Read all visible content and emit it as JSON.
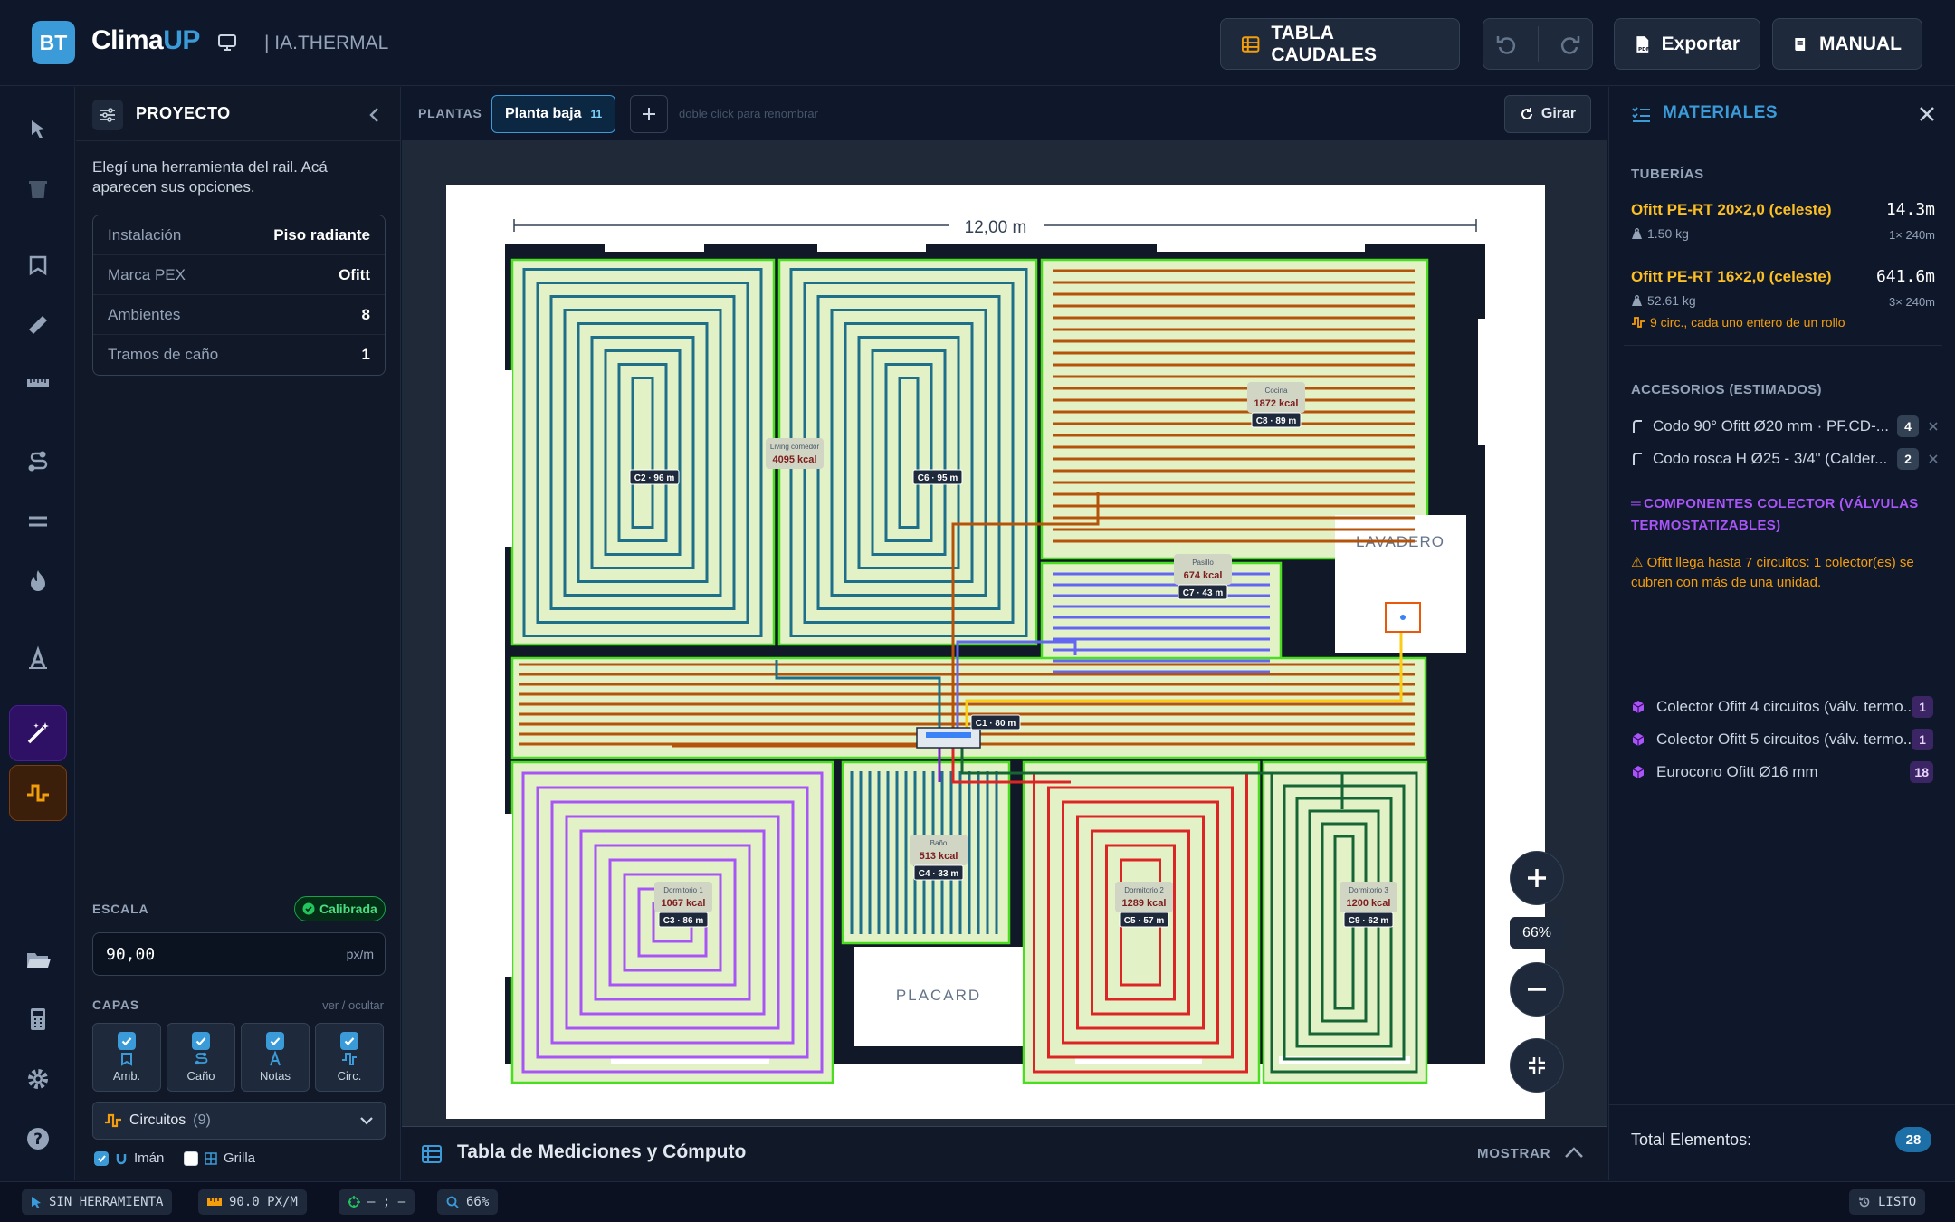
{
  "app": {
    "badge": "BT",
    "name_a": "Clima",
    "name_b": "UP",
    "subtitle": "| IA.THERMAL"
  },
  "toolbar": {
    "tabla": "TABLA CAUDALES",
    "exportar": "Exportar",
    "manual": "MANUAL"
  },
  "project": {
    "title": "PROYECTO",
    "hint": "Elegí una herramienta del rail. Acá aparecen sus opciones.",
    "rows": [
      {
        "label": "Instalación",
        "value": "Piso radiante"
      },
      {
        "label": "Marca PEX",
        "value": "Ofitt"
      },
      {
        "label": "Ambientes",
        "value": "8"
      },
      {
        "label": "Tramos de caño",
        "value": "1"
      }
    ],
    "escala_label": "ESCALA",
    "calibrada": "Calibrada",
    "escala_value": "90,00",
    "escala_unit": "px/m",
    "capas_label": "CAPAS",
    "ver_ocultar": "ver / ocultar",
    "layers": [
      {
        "label": "Amb."
      },
      {
        "label": "Caño"
      },
      {
        "label": "Notas"
      },
      {
        "label": "Circ."
      }
    ],
    "circuitos_label": "Circuitos",
    "circuitos_count": "(9)",
    "iman": "Imán",
    "grilla": "Grilla"
  },
  "plantas": {
    "label": "PLANTAS",
    "tab": "Planta baja",
    "tab_count": "11",
    "rename_hint": "doble click para renombrar",
    "girar": "Girar"
  },
  "plan": {
    "dimension": "12,00 m",
    "lavadero": "LAVADERO",
    "placard": "PLACARD",
    "rooms": [
      {
        "name": "Living comedor",
        "kcal": "4095 kcal"
      },
      {
        "name": "Cocina",
        "kcal": "1872 kcal"
      },
      {
        "name": "Pasillo",
        "kcal": "674 kcal"
      },
      {
        "name": "Baño",
        "kcal": "513 kcal"
      },
      {
        "name": "Dormitorio 1",
        "kcal": "1067 kcal"
      },
      {
        "name": "Dormitorio 2",
        "kcal": "1289 kcal"
      },
      {
        "name": "Dormitorio 3",
        "kcal": "1200 kcal"
      },
      {
        "name": "Pasillo",
        "kcal": ""
      }
    ],
    "circuits": [
      "C2 · 96 m",
      "C6 · 95 m",
      "C8 · 89 m",
      "C7 · 43 m",
      "C1 · 80 m",
      "C4 · 33 m",
      "C3 · 86 m",
      "C5 · 57 m",
      "C9 · 62 m"
    ]
  },
  "zoom": {
    "level": "66%"
  },
  "tabla_bar": {
    "title": "Tabla de Mediciones y Cómputo",
    "mostrar": "MOSTRAR"
  },
  "materials": {
    "title": "MATERIALES",
    "tuberias": "TUBERÍAS",
    "pipes": [
      {
        "name": "Ofitt PE-RT 20×2,0 (celeste)",
        "length": "14.3m",
        "weight": "1.50 kg",
        "rolls": "1× 240m"
      },
      {
        "name": "Ofitt PE-RT 16×2,0 (celeste)",
        "length": "641.6m",
        "weight": "52.61 kg",
        "rolls": "3× 240m",
        "note": "9 circ., cada uno entero de un rollo"
      }
    ],
    "accesorios": "ACCESORIOS (ESTIMADOS)",
    "acc": [
      {
        "name": "Codo 90° Ofitt Ø20 mm · PF.CD-...",
        "count": "4"
      },
      {
        "name": "Codo rosca H Ø25 - 3/4\" (Calder...",
        "count": "2"
      }
    ],
    "componentes": "COMPONENTES COLECTOR (VÁLVULAS TERMOSTATIZABLES)",
    "warning": "Ofitt llega hasta 7 circuitos: 1 colector(es) se cubren con más de una unidad.",
    "comps": [
      {
        "name": "Colector Ofitt 4 circuitos (válv. termo...",
        "count": "1"
      },
      {
        "name": "Colector Ofitt 5 circuitos (válv. termo...",
        "count": "1"
      },
      {
        "name": "Eurocono Ofitt Ø16 mm",
        "count": "18"
      }
    ],
    "total_label": "Total Elementos:",
    "total": "28"
  },
  "statusbar": {
    "tool": "SIN HERRAMIENTA",
    "scale": "90.0 PX/M",
    "coords": "– ; –",
    "zoom": "66%",
    "state": "LISTO"
  },
  "colors": {
    "accent": "#3b9bd9",
    "orange": "#f59e0b",
    "yellow_title": "#fbbf24",
    "purple": "#a855f7",
    "green_badge": "#16a34a"
  }
}
